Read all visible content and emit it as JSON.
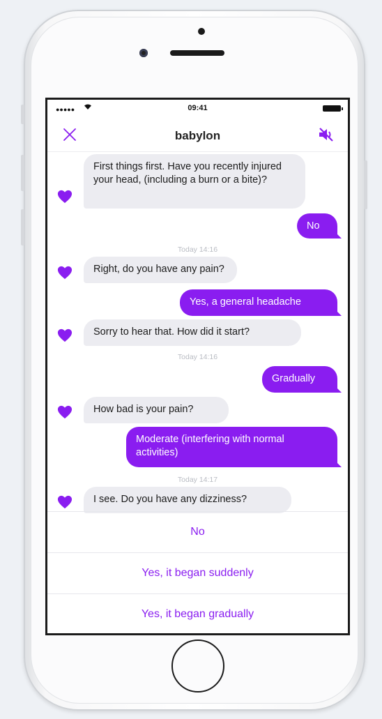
{
  "status_bar": {
    "signal": "●●●●●",
    "time": "09:41",
    "wifi_icon": "wifi-icon",
    "battery_icon": "battery-icon"
  },
  "nav": {
    "title": "babylon",
    "close_icon": "close-icon",
    "mute_icon": "speaker-muted-icon"
  },
  "accent_color": "#8A1DF0",
  "messages": [
    {
      "sender": "bot",
      "text": "First things first. Have you recently injured your head, (including a burn or a bite)?"
    },
    {
      "sender": "user",
      "text": "No"
    },
    {
      "type": "timestamp",
      "text": "Today 14:16"
    },
    {
      "sender": "bot",
      "text": "Right, do you have any pain?"
    },
    {
      "sender": "user",
      "text": "Yes, a general headache"
    },
    {
      "sender": "bot",
      "text": "Sorry to hear that. How did it start?"
    },
    {
      "type": "timestamp",
      "text": "Today 14:16"
    },
    {
      "sender": "user",
      "text": "Gradually"
    },
    {
      "sender": "bot",
      "text": "How bad is your pain?"
    },
    {
      "sender": "user",
      "text": "Moderate (interfering with normal activities)"
    },
    {
      "type": "timestamp",
      "text": "Today 14:17"
    },
    {
      "sender": "bot",
      "text": "I see. Do you have any dizziness?"
    }
  ],
  "options": [
    {
      "label": "No"
    },
    {
      "label": "Yes, it began suddenly"
    },
    {
      "label": "Yes, it began gradually"
    }
  ]
}
